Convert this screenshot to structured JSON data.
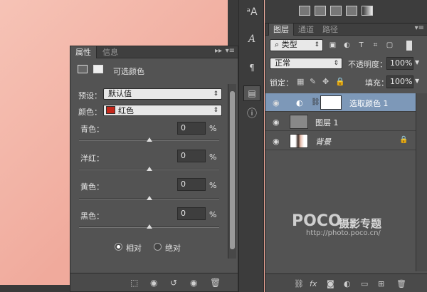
{
  "properties_panel": {
    "tabs": [
      "属性",
      "信息"
    ],
    "title": "可选颜色",
    "preset_label": "预设：",
    "preset_value": "默认值",
    "color_label": "颜色：",
    "color_value": "红色",
    "color_swatch": "#c4281b",
    "sliders": [
      {
        "label": "青色：",
        "value": "0",
        "unit": "%"
      },
      {
        "label": "洋红：",
        "value": "0",
        "unit": "%"
      },
      {
        "label": "黄色：",
        "value": "0",
        "unit": "%"
      },
      {
        "label": "黑色：",
        "value": "0",
        "unit": "%"
      }
    ],
    "mode_relative": "相对",
    "mode_absolute": "绝对"
  },
  "layers_panel": {
    "tabs": [
      "图层",
      "通道",
      "路径"
    ],
    "filter_type": "类型",
    "blend_mode": "正常",
    "opacity_label": "不透明度：",
    "opacity_value": "100%",
    "lock_label": "锁定：",
    "fill_label": "填充：",
    "fill_value": "100%",
    "layers": [
      {
        "name": "选取颜色 1",
        "selected": true
      },
      {
        "name": "图层 1",
        "selected": false
      },
      {
        "name": "背景",
        "selected": false
      }
    ]
  },
  "watermark": {
    "brand": "POCO",
    "brand_cn": "摄影专题",
    "url": "http://photo.poco.cn/"
  }
}
